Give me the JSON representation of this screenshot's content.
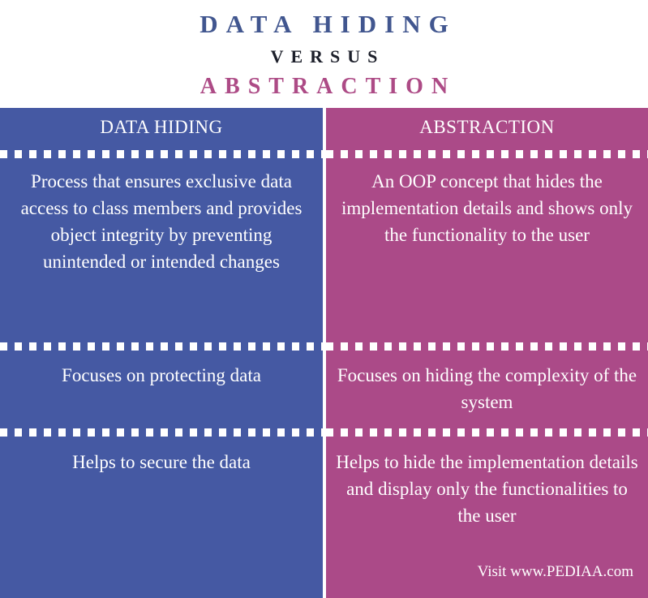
{
  "title": {
    "primary": "DATA HIDING",
    "connector": "VERSUS",
    "secondary": "ABSTRACTION"
  },
  "colors": {
    "left_panel": "#4559a3",
    "right_panel": "#ab4a88",
    "title_primary": "#41568f",
    "title_connector": "#1c1f2a",
    "title_secondary": "#ad4b86",
    "text": "#ffffff"
  },
  "comparison": {
    "left": {
      "header": "DATA HIDING",
      "rows": [
        "Process that ensures exclusive data access to class members and provides object integrity by preventing unintended or intended changes",
        "Focuses on protecting data",
        "Helps to secure the data"
      ]
    },
    "right": {
      "header": "ABSTRACTION",
      "rows": [
        "An OOP concept that hides the implementation details and shows only the functionality to the user",
        "Focuses on hiding the complexity of the system",
        "Helps to hide the implementation details and display only the functionalities to the user"
      ]
    }
  },
  "footer": {
    "attribution": "Visit www.PEDIAA.com"
  }
}
